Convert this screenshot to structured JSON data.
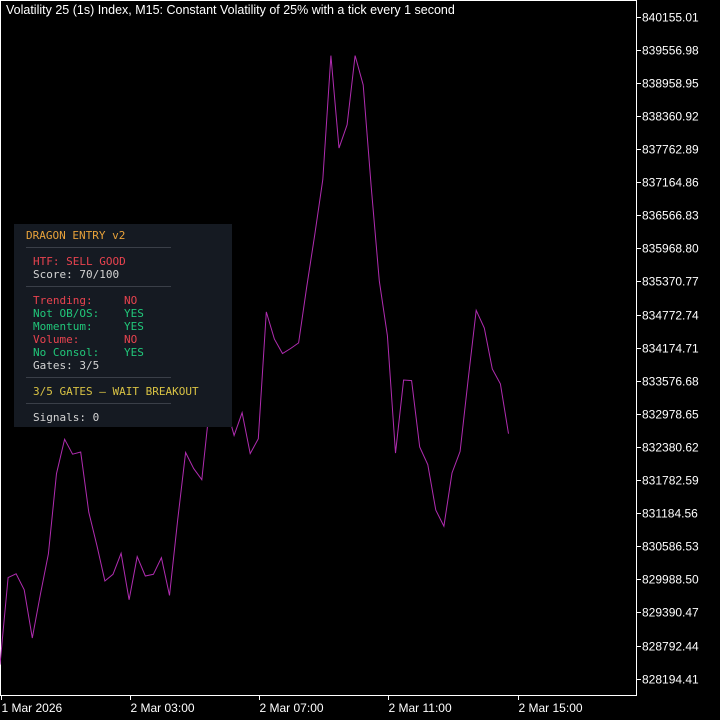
{
  "title": "Volatility 25 (1s) Index, M15:  Constant Volatility of 25% with a tick every 1 second",
  "colors": {
    "background": "#000000",
    "line": "#b02cb0",
    "axis": "#ffffff",
    "panel_bg": "#151a22",
    "orange": "#e8a23a",
    "red": "#e8434f",
    "green": "#21c77a",
    "gold": "#d8c244"
  },
  "chart_data": {
    "type": "line",
    "ylim": [
      827900,
      840455
    ],
    "yticks": [
      "840155.01",
      "839556.98",
      "838958.95",
      "838360.92",
      "837762.89",
      "837164.86",
      "836566.83",
      "835968.80",
      "835370.77",
      "834772.74",
      "834174.71",
      "833576.68",
      "832978.65",
      "832380.62",
      "831782.59",
      "831184.56",
      "830586.53",
      "829988.50",
      "829390.47",
      "828792.44",
      "828194.41"
    ],
    "xticks": [
      "1 Mar 2026",
      "2 Mar 03:00",
      "2 Mar 07:00",
      "2 Mar 11:00",
      "2 Mar 15:00"
    ],
    "xlim": [
      0,
      78.8
    ],
    "series": [
      {
        "x": [
          0,
          1,
          2,
          3,
          4,
          5,
          6,
          7,
          8,
          9,
          10,
          11,
          12,
          13,
          14,
          15,
          16,
          17,
          18,
          19,
          20,
          21,
          22,
          23,
          24,
          25,
          26,
          27,
          28,
          29,
          30,
          31,
          32,
          33,
          34,
          35,
          36,
          37,
          38,
          39,
          40,
          41,
          42,
          43,
          44,
          45,
          46,
          47,
          48,
          49,
          50,
          51,
          52,
          53,
          54,
          55,
          56,
          57,
          58,
          59,
          60,
          61,
          62,
          63
        ],
        "y": [
          828450,
          830020,
          830090,
          829800,
          828930,
          829720,
          830450,
          831900,
          832520,
          832250,
          832290,
          831200,
          830600,
          829960,
          830080,
          830460,
          829620,
          830400,
          830050,
          830080,
          830380,
          829700,
          831050,
          832280,
          831990,
          831790,
          833150,
          833210,
          833120,
          832590,
          833000,
          832260,
          832530,
          834820,
          834330,
          834070,
          834160,
          834260,
          835270,
          836220,
          837210,
          839450,
          837780,
          838200,
          839450,
          838920,
          837060,
          835380,
          834390,
          832270,
          833590,
          833580,
          832380,
          832060,
          831240,
          830950,
          831910,
          832300,
          833590,
          834850,
          834530,
          833790,
          833520,
          832620
        ]
      }
    ]
  },
  "panel": {
    "title": "DRAGON ENTRY v2",
    "htf": "HTF: SELL GOOD",
    "score": "Score: 70/100",
    "gates": [
      {
        "label": "Trending:",
        "value": "NO",
        "status": "red"
      },
      {
        "label": "Not OB/OS:",
        "value": "YES",
        "status": "green"
      },
      {
        "label": "Momentum:",
        "value": "YES",
        "status": "green"
      },
      {
        "label": "Volume:",
        "value": "NO",
        "status": "red"
      },
      {
        "label": "No Consol:",
        "value": "YES",
        "status": "green"
      }
    ],
    "gates_count": "Gates: 3/5",
    "verdict": "3/5 GATES — WAIT BREAKOUT",
    "signals": "Signals: 0"
  }
}
